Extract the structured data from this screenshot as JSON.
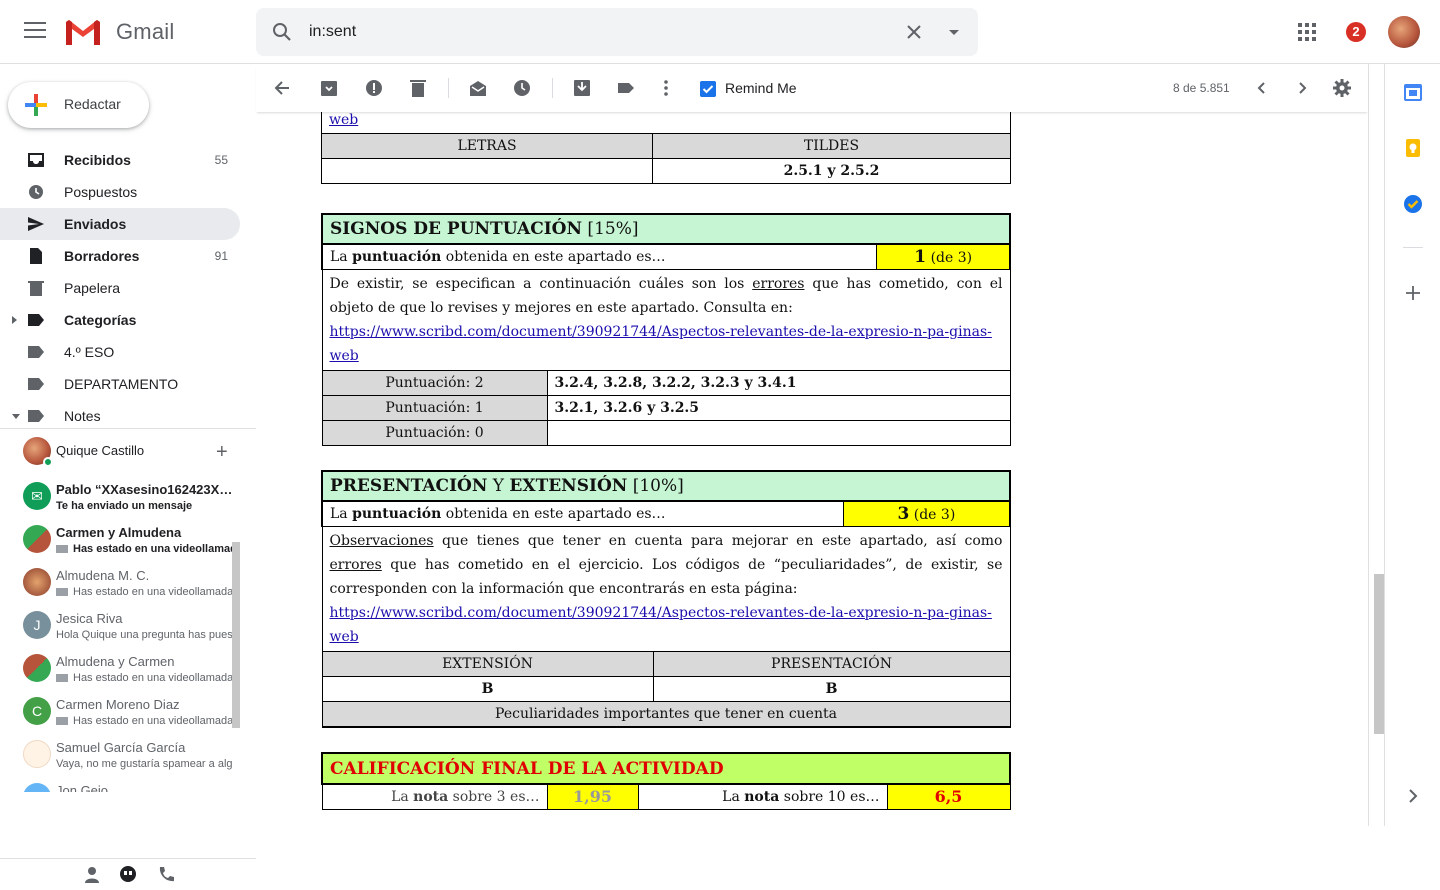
{
  "app": {
    "name": "Gmail"
  },
  "search": {
    "value": "in:sent"
  },
  "header": {
    "notifications": "2"
  },
  "compose": {
    "label": "Redactar"
  },
  "nav": [
    {
      "label": "Recibidos",
      "count": "55"
    },
    {
      "label": "Pospuestos",
      "count": ""
    },
    {
      "label": "Enviados",
      "count": ""
    },
    {
      "label": "Borradores",
      "count": "91"
    },
    {
      "label": "Papelera",
      "count": ""
    },
    {
      "label": "Categorías",
      "count": ""
    },
    {
      "label": "4.º ESO",
      "count": ""
    },
    {
      "label": "DEPARTAMENTO",
      "count": ""
    },
    {
      "label": "Notes",
      "count": ""
    }
  ],
  "chat": {
    "me": "Quique Castillo",
    "contacts": [
      {
        "name": "Pablo “XXasesino162423X…",
        "message": "Te ha enviado un mensaje"
      },
      {
        "name": "Carmen y Almudena",
        "message": "Has estado en una videollamada"
      },
      {
        "name": "Almudena M. C.",
        "message": "Has estado en una videollamada"
      },
      {
        "name": "Jesica Riva",
        "initial": "J",
        "message": "Hola Quique una pregunta has puesto"
      },
      {
        "name": "Almudena y Carmen",
        "message": "Has estado en una videollamada"
      },
      {
        "name": "Carmen Moreno Diaz",
        "initial": "C",
        "message": "Has estado en una videollamada"
      },
      {
        "name": "Samuel García García",
        "message": "Vaya, no me gustaría spamear a alguien"
      },
      {
        "name": "Jon Gejo",
        "message": ""
      }
    ]
  },
  "toolbar": {
    "remind_label": "Remind Me",
    "pager": "8 de 5.851"
  },
  "doc": {
    "top": {
      "link_tail": "web",
      "col1": "LETRAS",
      "col2": "TILDES",
      "val2": "2.5.1 y 2.5.2"
    },
    "punct": {
      "title": "SIGNOS DE PUNTUACIÓN",
      "pct": " [15%]",
      "score_pre": "La ",
      "score_bold": "puntuación",
      "score_post": " obtenida en este apartado es…",
      "score_value": "1",
      "score_of": " (de 3)",
      "desc_1": "De existir, se especifican a continuación cuáles son los ",
      "desc_u": "errores",
      "desc_2": " que has cometido, con el objeto de que lo revises y mejores en este apartado. Consulta en:",
      "link": "https://www.scribd.com/document/390921744/Aspectos-relevantes-de-la-expresio-n-pa-ginas-web",
      "rows": [
        {
          "label": "Puntuación: 2",
          "value": "3.2.4, 3.2.8, 3.2.2, 3.2.3 y 3.4.1"
        },
        {
          "label": "Puntuación: 1",
          "value": "3.2.1, 3.2.6 y 3.2.5"
        },
        {
          "label": "Puntuación: 0",
          "value": ""
        }
      ]
    },
    "pres": {
      "title_a": "PRESENTACIÓN",
      "title_y": " Y ",
      "title_b": "EXTENSIÓN",
      "pct": " [10%]",
      "score_pre": "La ",
      "score_bold": "puntuación",
      "score_post": " obtenida en este apartado es…",
      "score_value": "3",
      "score_of": " (de 3)",
      "obs_u": "Observaciones",
      "obs_1": " que tienes que tener en cuenta para mejorar en este apartado, así como ",
      "obs_u2": "errores",
      "obs_2": " que has cometido en el ejercicio. Los códigos de “peculiaridades”, de existir, se corresponden con la información que encontrarás en esta página:",
      "link": "https://www.scribd.com/document/390921744/Aspectos-relevantes-de-la-expresio-n-pa-ginas-web",
      "col1": "EXTENSIÓN",
      "col2": "PRESENTACIÓN",
      "val1": "B",
      "val2": "B",
      "peculiar": "Peculiaridades importantes que tener en cuenta"
    },
    "final": {
      "title": "CALIFICACIÓN FINAL DE LA ACTIVIDAD",
      "l1_pre": "La ",
      "l1_bold": "nota",
      "l1_post": " sobre 3 es…",
      "v1": "1,95",
      "l2_pre": "La ",
      "l2_bold": "nota",
      "l2_post": " sobre 10 es…",
      "v2": "6,5"
    }
  },
  "colors": {
    "accent": "#1a73e8",
    "header_green": "#c6f5d3",
    "highlight_yellow": "#ffff00",
    "final_lime": "#c0ff66",
    "final_red": "#e00000"
  }
}
